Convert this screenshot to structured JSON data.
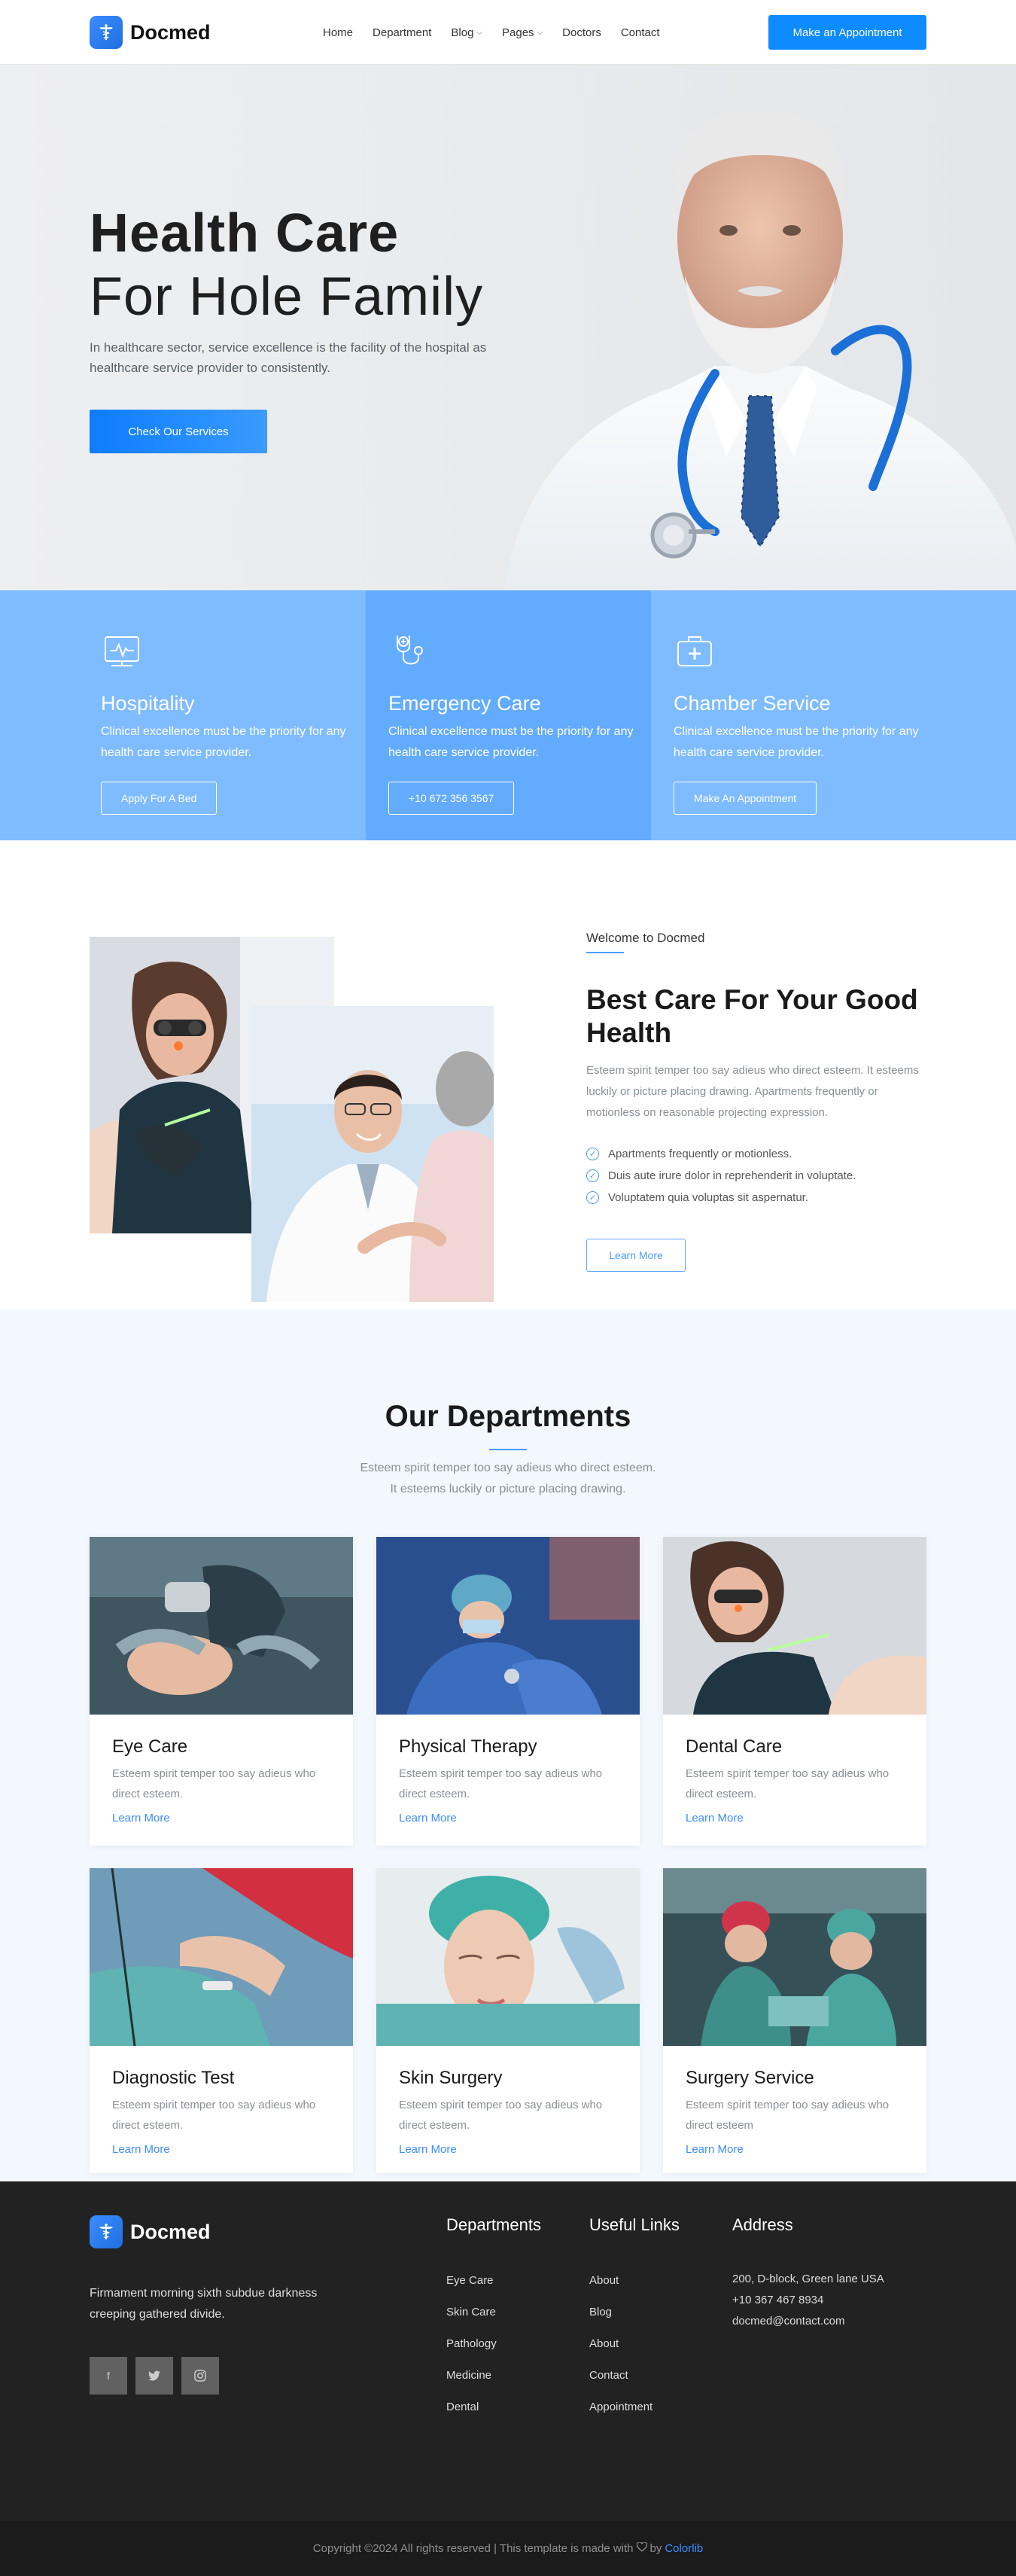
{
  "header": {
    "brand": "Docmed",
    "nav": [
      {
        "label": "Home",
        "has_dropdown": false
      },
      {
        "label": "Department",
        "has_dropdown": false
      },
      {
        "label": "Blog",
        "has_dropdown": true
      },
      {
        "label": "Pages",
        "has_dropdown": true
      },
      {
        "label": "Doctors",
        "has_dropdown": false
      },
      {
        "label": "Contact",
        "has_dropdown": false
      }
    ],
    "cta": "Make an Appointment"
  },
  "hero": {
    "title_bold": "Health Care",
    "title_light": "For Hole Family",
    "text": "In healthcare sector, service excellence is the facility of the hospital as healthcare service provider to consistently.",
    "button": "Check Our Services"
  },
  "services": [
    {
      "icon": "monitor-heartbeat-icon",
      "title": "Hospitality",
      "text": "Clinical excellence must be the priority for any health care service provider.",
      "button": "Apply For A Bed"
    },
    {
      "icon": "stethoscope-icon",
      "title": "Emergency Care",
      "text": "Clinical excellence must be the priority for any health care service provider.",
      "button": "+10 672 356 3567"
    },
    {
      "icon": "first-aid-kit-icon",
      "title": "Chamber Service",
      "text": "Clinical excellence must be the priority for any health care service provider.",
      "button": "Make An Appointment"
    }
  ],
  "about": {
    "welcome": "Welcome to Docmed",
    "title": "Best Care For Your Good Health",
    "text": "Esteem spirit temper too say adieus who direct esteem. It esteems luckily or picture placing drawing. Apartments frequently or motionless on reasonable projecting expression.",
    "checks": [
      "Apartments frequently or motionless.",
      "Duis aute irure dolor in reprehenderit in voluptate.",
      "Voluptatem quia voluptas sit aspernatur."
    ],
    "button": "Learn More"
  },
  "departments": {
    "title": "Our Departments",
    "subtitle_1": "Esteem spirit temper too say adieus who direct esteem.",
    "subtitle_2": "It esteems luckily or picture placing drawing.",
    "items": [
      {
        "title": "Eye Care",
        "text": "Esteem spirit temper too say adieus who direct esteem.",
        "link": "Learn More"
      },
      {
        "title": "Physical Therapy",
        "text": "Esteem spirit temper too say adieus who direct esteem.",
        "link": "Learn More"
      },
      {
        "title": "Dental Care",
        "text": "Esteem spirit temper too say adieus who direct esteem.",
        "link": "Learn More"
      },
      {
        "title": "Diagnostic Test",
        "text": "Esteem spirit temper too say adieus who direct esteem.",
        "link": "Learn More"
      },
      {
        "title": "Skin Surgery",
        "text": "Esteem spirit temper too say adieus who direct esteem.",
        "link": "Learn More"
      },
      {
        "title": "Surgery Service",
        "text": "Esteem spirit temper too say adieus who direct esteem",
        "link": "Learn More"
      }
    ]
  },
  "footer": {
    "brand": "Docmed",
    "about": "Firmament morning sixth subdue darkness creeping gathered divide.",
    "social": [
      "f",
      "t",
      "i"
    ],
    "departments_title": "Departments",
    "departments": [
      "Eye Care",
      "Skin Care",
      "Pathology",
      "Medicine",
      "Dental"
    ],
    "links_title": "Useful Links",
    "links": [
      "About",
      "Blog",
      "About",
      "Contact",
      "Appointment"
    ],
    "address_title": "Address",
    "address_1": "200, D-block, Green lane USA",
    "address_2": "+10 367 467 8934",
    "address_3": "docmed@contact.com",
    "copyright_pre": "Copyright ©2024 All rights reserved | This template is made with",
    "copyright_by": "by",
    "copyright_brand": "Colorlib"
  },
  "colors": {
    "accent": "#0d8bff",
    "service_bg": "#7fbcff",
    "service_bg_alt": "#63abfd",
    "footer_bg": "#222222",
    "link": "#3b8cff"
  }
}
